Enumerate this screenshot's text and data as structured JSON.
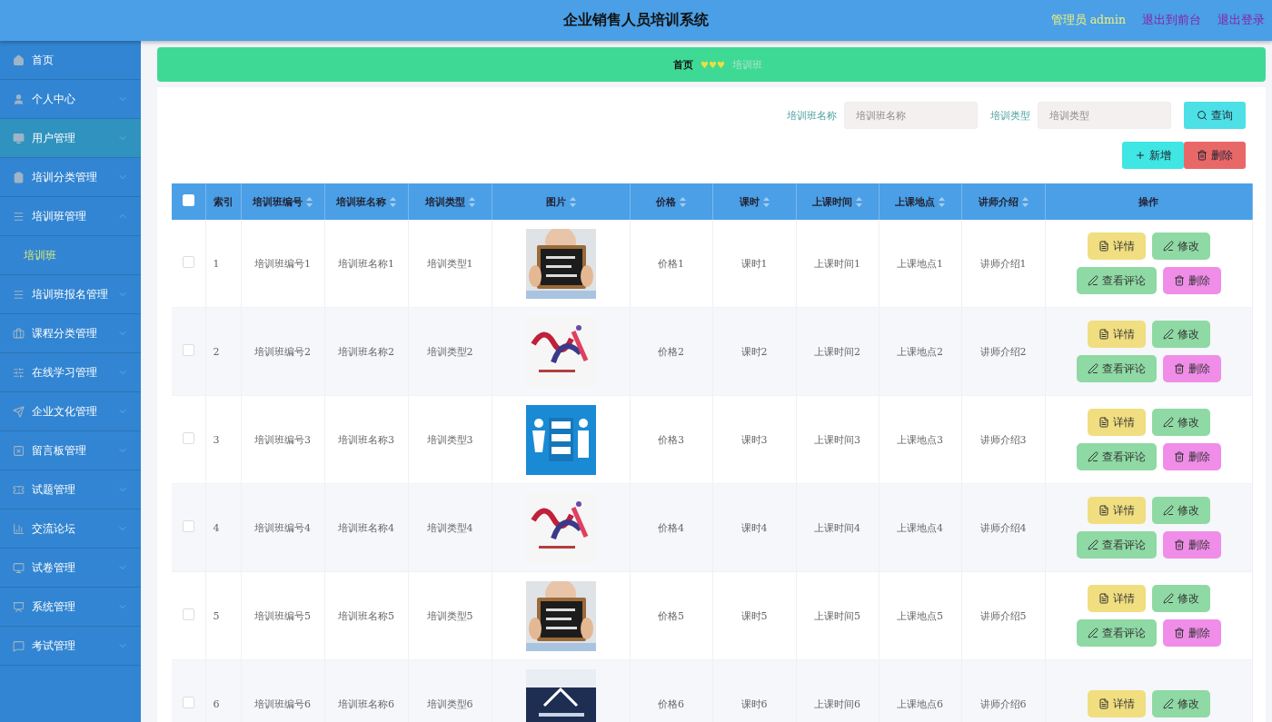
{
  "header": {
    "title": "企业销售人员培训系统",
    "user": "管理员 admin",
    "links": [
      "退出到前台",
      "退出登录"
    ]
  },
  "sidebar": {
    "items": [
      {
        "label": "首页",
        "kind": "link",
        "selected": false
      },
      {
        "label": "个人中心",
        "kind": "menu",
        "selected": false,
        "expanded": false
      },
      {
        "label": "用户管理",
        "kind": "menu",
        "selected": true,
        "expanded": false
      },
      {
        "label": "培训分类管理",
        "kind": "menu",
        "selected": false,
        "expanded": false
      },
      {
        "label": "培训班管理",
        "kind": "menu",
        "selected": false,
        "expanded": true,
        "children": [
          {
            "label": "培训班",
            "selected": true
          }
        ]
      },
      {
        "label": "培训班报名管理",
        "kind": "menu",
        "selected": false,
        "expanded": false
      },
      {
        "label": "课程分类管理",
        "kind": "menu",
        "selected": false,
        "expanded": false
      },
      {
        "label": "在线学习管理",
        "kind": "menu",
        "selected": false,
        "expanded": false
      },
      {
        "label": "企业文化管理",
        "kind": "menu",
        "selected": false,
        "expanded": false
      },
      {
        "label": "留言板管理",
        "kind": "menu",
        "selected": false,
        "expanded": false
      },
      {
        "label": "试题管理",
        "kind": "menu",
        "selected": false,
        "expanded": false
      },
      {
        "label": "交流论坛",
        "kind": "menu",
        "selected": false,
        "expanded": false
      },
      {
        "label": "试卷管理",
        "kind": "menu",
        "selected": false,
        "expanded": false
      },
      {
        "label": "系统管理",
        "kind": "menu",
        "selected": false,
        "expanded": false
      },
      {
        "label": "考试管理",
        "kind": "menu",
        "selected": false,
        "expanded": false
      }
    ]
  },
  "breadcrumb": {
    "home": "首页",
    "separator": "♥♥♥",
    "current": "培训班"
  },
  "search": {
    "fields": [
      {
        "label": "培训班名称",
        "placeholder": "培训班名称"
      },
      {
        "label": "培训类型",
        "placeholder": "培训类型"
      }
    ],
    "button": "查询"
  },
  "actions": {
    "add": "新增",
    "delete": "删除"
  },
  "table": {
    "header_checked": false,
    "columns": [
      {
        "label": "索引",
        "sortable": false
      },
      {
        "label": "培训班编号",
        "sortable": true
      },
      {
        "label": "培训班名称",
        "sortable": true
      },
      {
        "label": "培训类型",
        "sortable": true
      },
      {
        "label": "图片",
        "sortable": true
      },
      {
        "label": "价格",
        "sortable": true
      },
      {
        "label": "课时",
        "sortable": true
      },
      {
        "label": "上课时间",
        "sortable": true
      },
      {
        "label": "上课地点",
        "sortable": true
      },
      {
        "label": "讲师介绍",
        "sortable": true
      },
      {
        "label": "操作",
        "sortable": false
      }
    ],
    "rows": [
      {
        "checked": false,
        "cells": [
          {
            "kind": "text",
            "text": "1"
          },
          {
            "kind": "text",
            "text": "培训班编号1"
          },
          {
            "kind": "text",
            "text": "培训班名称1"
          },
          {
            "kind": "text",
            "text": "培训类型1"
          },
          {
            "kind": "picture"
          },
          {
            "kind": "text",
            "text": "价格1"
          },
          {
            "kind": "text",
            "text": "课时1"
          },
          {
            "kind": "text",
            "text": "上课时间1"
          },
          {
            "kind": "text",
            "text": "上课地点1"
          },
          {
            "kind": "text",
            "text": "讲师介绍1"
          }
        ],
        "buttons": [
          "详情",
          "修改",
          "查看评论",
          "删除"
        ]
      },
      {
        "checked": false,
        "cells": [
          {
            "kind": "text",
            "text": "2"
          },
          {
            "kind": "text",
            "text": "培训班编号2"
          },
          {
            "kind": "text",
            "text": "培训班名称2"
          },
          {
            "kind": "text",
            "text": "培训类型2"
          },
          {
            "kind": "picture"
          },
          {
            "kind": "text",
            "text": "价格2"
          },
          {
            "kind": "text",
            "text": "课时2"
          },
          {
            "kind": "text",
            "text": "上课时间2"
          },
          {
            "kind": "text",
            "text": "上课地点2"
          },
          {
            "kind": "text",
            "text": "讲师介绍2"
          }
        ],
        "buttons": [
          "详情",
          "修改",
          "查看评论",
          "删除"
        ]
      },
      {
        "checked": false,
        "cells": [
          {
            "kind": "text",
            "text": "3"
          },
          {
            "kind": "text",
            "text": "培训班编号3"
          },
          {
            "kind": "text",
            "text": "培训班名称3"
          },
          {
            "kind": "text",
            "text": "培训类型3"
          },
          {
            "kind": "picture"
          },
          {
            "kind": "text",
            "text": "价格3"
          },
          {
            "kind": "text",
            "text": "课时3"
          },
          {
            "kind": "text",
            "text": "上课时间3"
          },
          {
            "kind": "text",
            "text": "上课地点3"
          },
          {
            "kind": "text",
            "text": "讲师介绍3"
          }
        ],
        "buttons": [
          "详情",
          "修改",
          "查看评论",
          "删除"
        ]
      },
      {
        "checked": false,
        "cells": [
          {
            "kind": "text",
            "text": "4"
          },
          {
            "kind": "text",
            "text": "培训班编号4"
          },
          {
            "kind": "text",
            "text": "培训班名称4"
          },
          {
            "kind": "text",
            "text": "培训类型4"
          },
          {
            "kind": "picture"
          },
          {
            "kind": "text",
            "text": "价格4"
          },
          {
            "kind": "text",
            "text": "课时4"
          },
          {
            "kind": "text",
            "text": "上课时间4"
          },
          {
            "kind": "text",
            "text": "上课地点4"
          },
          {
            "kind": "text",
            "text": "讲师介绍4"
          }
        ],
        "buttons": [
          "详情",
          "修改",
          "查看评论",
          "删除"
        ]
      },
      {
        "checked": false,
        "cells": [
          {
            "kind": "text",
            "text": "5"
          },
          {
            "kind": "text",
            "text": "培训班编号5"
          },
          {
            "kind": "text",
            "text": "培训班名称5"
          },
          {
            "kind": "text",
            "text": "培训类型5"
          },
          {
            "kind": "picture"
          },
          {
            "kind": "text",
            "text": "价格5"
          },
          {
            "kind": "text",
            "text": "课时5"
          },
          {
            "kind": "text",
            "text": "上课时间5"
          },
          {
            "kind": "text",
            "text": "上课地点5"
          },
          {
            "kind": "text",
            "text": "讲师介绍5"
          }
        ],
        "buttons": [
          "详情",
          "修改",
          "查看评论",
          "删除"
        ]
      },
      {
        "checked": false,
        "cells": [
          {
            "kind": "text",
            "text": "6"
          },
          {
            "kind": "text",
            "text": "培训班编号6"
          },
          {
            "kind": "text",
            "text": "培训班名称6"
          },
          {
            "kind": "text",
            "text": "培训类型6"
          },
          {
            "kind": "picture"
          },
          {
            "kind": "text",
            "text": "价格6"
          },
          {
            "kind": "text",
            "text": "课时6"
          },
          {
            "kind": "text",
            "text": "上课时间6"
          },
          {
            "kind": "text",
            "text": "上课地点6"
          },
          {
            "kind": "text",
            "text": "讲师介绍6"
          }
        ],
        "buttons": [
          "详情",
          "修改"
        ]
      }
    ]
  }
}
